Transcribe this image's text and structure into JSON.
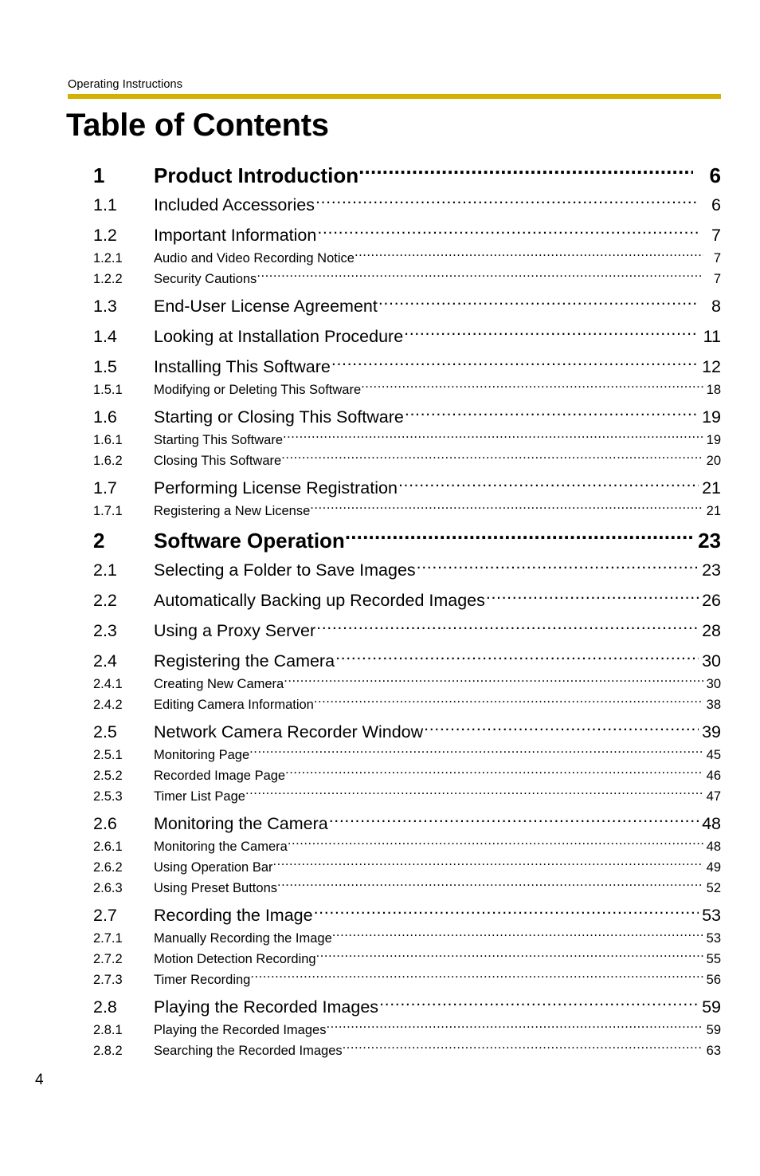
{
  "header": {
    "running_title": "Operating Instructions",
    "rule_color": "#d4b000"
  },
  "title": "Table of Contents",
  "folio": {
    "page_number": "4"
  },
  "toc": {
    "entries": [
      {
        "level": 1,
        "number": "1",
        "title": "Product Introduction",
        "page": "6"
      },
      {
        "level": 2,
        "number": "1.1",
        "title": "Included Accessories",
        "page": "6"
      },
      {
        "level": 2,
        "number": "1.2",
        "title": "Important Information",
        "page": "7"
      },
      {
        "level": 3,
        "number": "1.2.1",
        "title": "Audio and Video Recording Notice",
        "page": "7"
      },
      {
        "level": 3,
        "number": "1.2.2",
        "title": "Security Cautions",
        "page": "7"
      },
      {
        "level": 2,
        "number": "1.3",
        "title": "End-User License Agreement",
        "page": "8"
      },
      {
        "level": 2,
        "number": "1.4",
        "title": "Looking at Installation Procedure",
        "page": "11"
      },
      {
        "level": 2,
        "number": "1.5",
        "title": "Installing This Software",
        "page": "12"
      },
      {
        "level": 3,
        "number": "1.5.1",
        "title": "Modifying or Deleting This Software",
        "page": "18"
      },
      {
        "level": 2,
        "number": "1.6",
        "title": "Starting or Closing This Software",
        "page": "19"
      },
      {
        "level": 3,
        "number": "1.6.1",
        "title": "Starting This Software",
        "page": "19"
      },
      {
        "level": 3,
        "number": "1.6.2",
        "title": "Closing This Software",
        "page": "20"
      },
      {
        "level": 2,
        "number": "1.7",
        "title": "Performing License Registration",
        "page": "21"
      },
      {
        "level": 3,
        "number": "1.7.1",
        "title": "Registering a New License",
        "page": "21"
      },
      {
        "level": 1,
        "number": "2",
        "title": "Software Operation",
        "page": "23"
      },
      {
        "level": 2,
        "number": "2.1",
        "title": "Selecting a Folder to Save Images",
        "page": "23"
      },
      {
        "level": 2,
        "number": "2.2",
        "title": "Automatically Backing up Recorded Images",
        "page": "26"
      },
      {
        "level": 2,
        "number": "2.3",
        "title": "Using a Proxy Server",
        "page": "28"
      },
      {
        "level": 2,
        "number": "2.4",
        "title": "Registering the Camera",
        "page": "30"
      },
      {
        "level": 3,
        "number": "2.4.1",
        "title": "Creating New Camera",
        "page": "30"
      },
      {
        "level": 3,
        "number": "2.4.2",
        "title": "Editing Camera Information",
        "page": "38"
      },
      {
        "level": 2,
        "number": "2.5",
        "title": "Network Camera Recorder Window",
        "page": "39"
      },
      {
        "level": 3,
        "number": "2.5.1",
        "title": "Monitoring Page",
        "page": "45"
      },
      {
        "level": 3,
        "number": "2.5.2",
        "title": "Recorded Image Page",
        "page": "46"
      },
      {
        "level": 3,
        "number": "2.5.3",
        "title": "Timer List Page",
        "page": "47"
      },
      {
        "level": 2,
        "number": "2.6",
        "title": "Monitoring the Camera",
        "page": "48"
      },
      {
        "level": 3,
        "number": "2.6.1",
        "title": "Monitoring the Camera",
        "page": "48"
      },
      {
        "level": 3,
        "number": "2.6.2",
        "title": "Using Operation Bar",
        "page": "49"
      },
      {
        "level": 3,
        "number": "2.6.3",
        "title": "Using Preset Buttons",
        "page": "52"
      },
      {
        "level": 2,
        "number": "2.7",
        "title": "Recording the Image",
        "page": "53"
      },
      {
        "level": 3,
        "number": "2.7.1",
        "title": "Manually Recording the Image",
        "page": "53"
      },
      {
        "level": 3,
        "number": "2.7.2",
        "title": "Motion Detection Recording",
        "page": "55"
      },
      {
        "level": 3,
        "number": "2.7.3",
        "title": "Timer Recording",
        "page": "56"
      },
      {
        "level": 2,
        "number": "2.8",
        "title": "Playing the Recorded Images",
        "page": "59"
      },
      {
        "level": 3,
        "number": "2.8.1",
        "title": "Playing the Recorded Images",
        "page": "59"
      },
      {
        "level": 3,
        "number": "2.8.2",
        "title": "Searching the Recorded Images",
        "page": "63"
      }
    ]
  }
}
